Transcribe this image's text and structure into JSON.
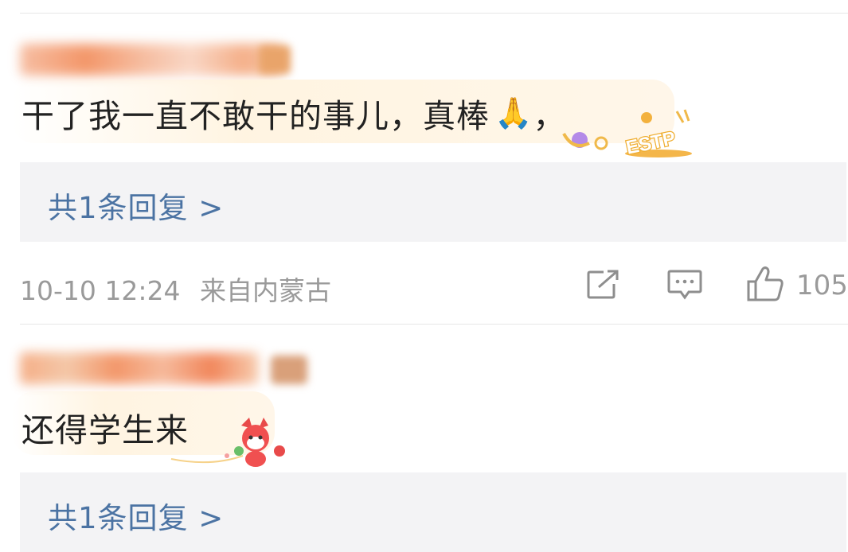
{
  "comments": [
    {
      "text": "干了我一直不敢干的事儿，真棒",
      "emoji": "🙏",
      "trailing_punct": "，",
      "badge_label": "ESTP",
      "reply_label": "共1条回复 >",
      "timestamp": "10-10 12:24",
      "location": "来自内蒙古",
      "like_count": "105"
    },
    {
      "text": "还得学生来",
      "reply_label": "共1条回复 >"
    }
  ],
  "colors": {
    "username": "#f07a2a",
    "reply_link": "#4b73a3",
    "meta_text": "#9a9a9a",
    "comment_text": "#222222",
    "reply_bg": "#f3f3f5"
  },
  "icons": [
    "share-icon",
    "comment-icon",
    "like-icon"
  ]
}
